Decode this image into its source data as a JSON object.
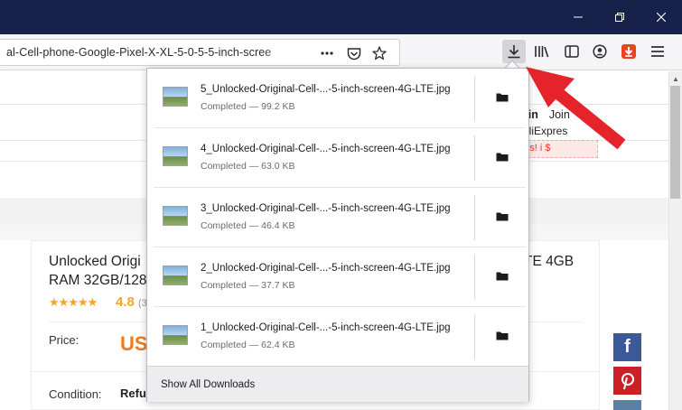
{
  "window": {
    "minimize_icon": "minimize-icon",
    "maximize_icon": "restore-icon",
    "close_icon": "close-icon"
  },
  "navbar": {
    "url_text": "al-Cell-phone-Google-Pixel-X-XL-5-0-5-5-inch-scree",
    "page_actions_icon": "more-actions-icon",
    "pocket_icon": "pocket-icon",
    "bookmark_icon": "star-icon",
    "toolbar_icons": [
      "download-icon",
      "library-icon",
      "sidebar-icon",
      "account-icon",
      "extension-icon",
      "menu-icon"
    ],
    "extension_color": "#e8451e",
    "annotation_color": "#e5232b"
  },
  "background_page": {
    "product_title": "Unlocked Origi",
    "product_title_right": "TE 4GB",
    "product_title_line2": "RAM 32GB/128",
    "stars": "★★★★★",
    "rating": "4.8",
    "rating_count": "(3",
    "price_label": "Price:",
    "price_value": "US",
    "condition_label": "Condition:",
    "condition_value": "Refu",
    "sign_in": "gn in",
    "join": "Join",
    "aliexpress": "y AliExpres",
    "promo": "ons!   i   $",
    "social": [
      {
        "name": "facebook",
        "glyph": "f",
        "color": "#3b5998"
      },
      {
        "name": "pinterest",
        "glyph": "P",
        "color": "#cb2027"
      },
      {
        "name": "vk",
        "glyph": "",
        "color": "#5c7fa6"
      }
    ]
  },
  "downloads": {
    "items": [
      {
        "filename": "5_Unlocked-Original-Cell-...-5-inch-screen-4G-LTE.jpg",
        "status": "Completed — 99.2 KB"
      },
      {
        "filename": "4_Unlocked-Original-Cell-...-5-inch-screen-4G-LTE.jpg",
        "status": "Completed — 63.0 KB"
      },
      {
        "filename": "3_Unlocked-Original-Cell-...-5-inch-screen-4G-LTE.jpg",
        "status": "Completed — 46.4 KB"
      },
      {
        "filename": "2_Unlocked-Original-Cell-...-5-inch-screen-4G-LTE.jpg",
        "status": "Completed — 37.7 KB"
      },
      {
        "filename": "1_Unlocked-Original-Cell-...-5-inch-screen-4G-LTE.jpg",
        "status": "Completed — 62.4 KB"
      }
    ],
    "folder_icon": "folder-icon",
    "footer_label": "Show All Downloads"
  }
}
